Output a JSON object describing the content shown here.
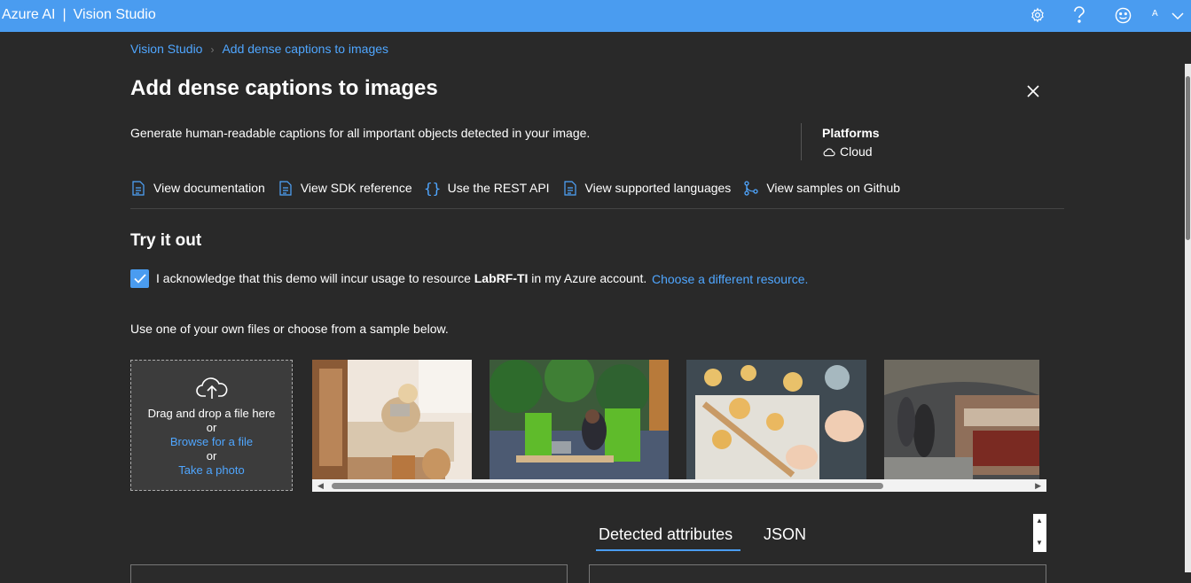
{
  "topbar": {
    "brand": "Azure AI",
    "separator": "|",
    "product": "Vision Studio",
    "avatar_initial": "A",
    "color": "#4a9cf0"
  },
  "breadcrumb": {
    "root": "Vision Studio",
    "current": "Add dense captions to images"
  },
  "page": {
    "title": "Add dense captions to images",
    "description": "Generate human-readable captions for all important objects detected in your image.",
    "platforms_heading": "Platforms",
    "platform": "Cloud"
  },
  "links": {
    "documentation": "View documentation",
    "sdk": "View SDK reference",
    "rest": "Use the REST API",
    "languages": "View supported languages",
    "github": "View samples on Github"
  },
  "try": {
    "heading": "Try it out",
    "ack_before": "I acknowledge that this demo will incur usage to resource ",
    "resource": "LabRF-TI",
    "ack_after": " in my Azure account.",
    "choose_link": "Choose a different resource.",
    "acknowledged": true,
    "instruction": "Use one of your own files or choose from a sample below."
  },
  "upload": {
    "drag_text": "Drag and drop a file here",
    "or1": "or",
    "browse": "Browse for a file",
    "or2": "or",
    "photo": "Take a photo"
  },
  "samples": [
    "woman-with-laptop-and-dog",
    "woman-at-desk-office",
    "pasta-making",
    "subway-platform"
  ],
  "tabs": {
    "detected": "Detected attributes",
    "json": "JSON",
    "active": "Detected attributes"
  },
  "colors": {
    "accent": "#4a9cf0",
    "link": "#4fa6ff",
    "background": "#292929"
  }
}
